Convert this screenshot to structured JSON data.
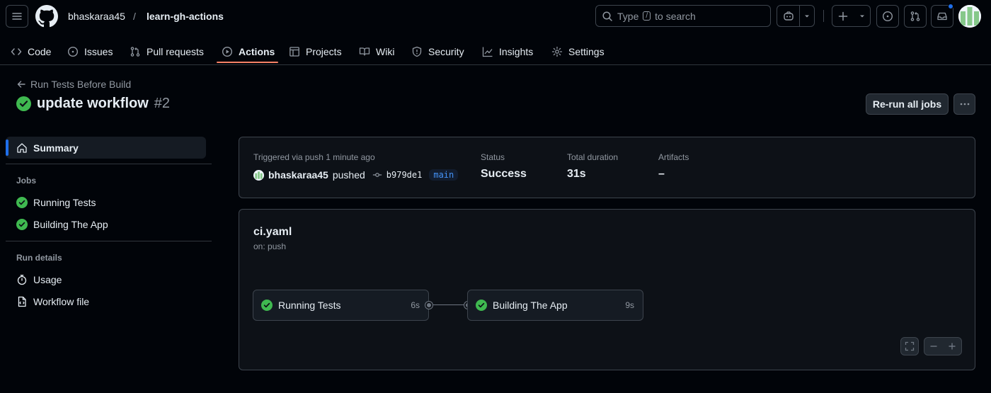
{
  "header": {
    "owner": "bhaskaraa45",
    "separator": "/",
    "repo": "learn-gh-actions",
    "search": {
      "prefix": "Type",
      "key": "/",
      "suffix": "to search"
    }
  },
  "nav": [
    {
      "label": "Code",
      "icon": "code-icon"
    },
    {
      "label": "Issues",
      "icon": "issue-opened-icon"
    },
    {
      "label": "Pull requests",
      "icon": "git-pull-request-icon"
    },
    {
      "label": "Actions",
      "icon": "play-icon",
      "active": true
    },
    {
      "label": "Projects",
      "icon": "table-icon"
    },
    {
      "label": "Wiki",
      "icon": "book-icon"
    },
    {
      "label": "Security",
      "icon": "shield-icon"
    },
    {
      "label": "Insights",
      "icon": "graph-icon"
    },
    {
      "label": "Settings",
      "icon": "gear-icon"
    }
  ],
  "run": {
    "workflow_name": "Run Tests Before Build",
    "title": "update workflow",
    "number": "#2",
    "rerun_label": "Re-run all jobs"
  },
  "sidebar": {
    "summary": "Summary",
    "jobs_heading": "Jobs",
    "jobs": [
      "Running Tests",
      "Building The App"
    ],
    "details_heading": "Run details",
    "details": [
      "Usage",
      "Workflow file"
    ]
  },
  "summary": {
    "trigger": "Triggered via push 1 minute ago",
    "actor": "bhaskaraa45",
    "action": "pushed",
    "commit": "b979de1",
    "branch": "main",
    "status_label": "Status",
    "status_value": "Success",
    "duration_label": "Total duration",
    "duration_value": "31s",
    "artifacts_label": "Artifacts",
    "artifacts_value": "–"
  },
  "graph": {
    "file": "ci.yaml",
    "trigger": "on: push",
    "jobs": [
      {
        "name": "Running Tests",
        "duration": "6s"
      },
      {
        "name": "Building The App",
        "duration": "9s"
      }
    ]
  },
  "colors": {
    "success": "#3fb950",
    "accent": "#f78166",
    "link": "#4493f8",
    "notification": "#1f6feb"
  }
}
